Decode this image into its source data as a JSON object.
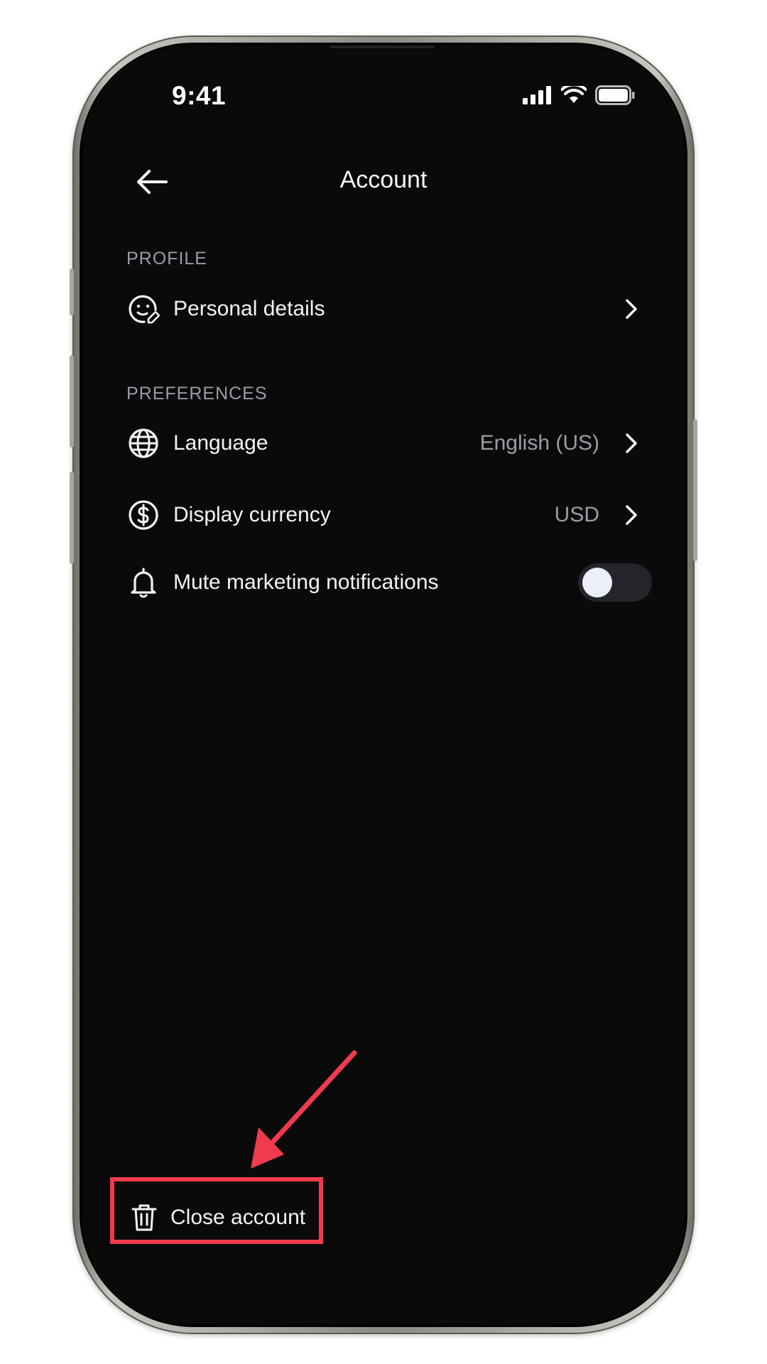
{
  "status_bar": {
    "time": "9:41"
  },
  "header": {
    "title": "Account"
  },
  "sections": {
    "profile": {
      "label": "PROFILE",
      "items": [
        {
          "label": "Personal details",
          "icon": "face-edit-icon"
        }
      ]
    },
    "preferences": {
      "label": "PREFERENCES",
      "items": [
        {
          "label": "Language",
          "value": "English (US)",
          "icon": "globe-icon"
        },
        {
          "label": "Display currency",
          "value": "USD",
          "icon": "dollar-circle-icon"
        },
        {
          "label": "Mute marketing notifications",
          "icon": "bell-icon",
          "toggle_on": false
        }
      ]
    }
  },
  "footer": {
    "close_label": "Close account",
    "icon": "trash-icon"
  },
  "colors": {
    "background": "#0a0a0a",
    "text_primary": "#f3f3f5",
    "text_secondary": "#9a9ca8",
    "highlight": "#ef3b4d"
  }
}
